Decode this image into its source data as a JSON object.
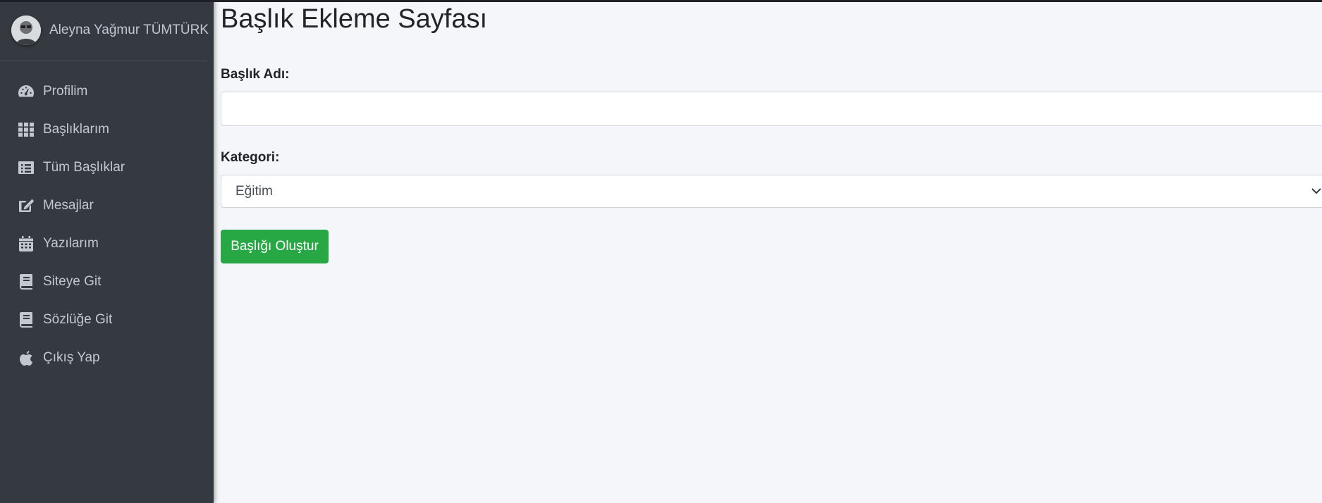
{
  "user": {
    "name": "Aleyna Yağmur TÜMTÜRK"
  },
  "sidebar": {
    "items": [
      {
        "label": "Profilim",
        "icon": "dashboard-icon"
      },
      {
        "label": "Başlıklarım",
        "icon": "grid-icon"
      },
      {
        "label": "Tüm Başlıklar",
        "icon": "list-icon"
      },
      {
        "label": "Mesajlar",
        "icon": "edit-icon"
      },
      {
        "label": "Yazılarım",
        "icon": "calendar-icon"
      },
      {
        "label": "Siteye Git",
        "icon": "book-icon"
      },
      {
        "label": "Sözlüğe Git",
        "icon": "book-icon"
      },
      {
        "label": "Çıkış Yap",
        "icon": "apple-icon"
      }
    ]
  },
  "main": {
    "title": "Başlık Ekleme Sayfası",
    "title_label": "Başlık Adı:",
    "title_value": "",
    "category_label": "Kategori:",
    "category_selected": "Eğitim",
    "submit_label": "Başlığı Oluştur"
  },
  "colors": {
    "sidebar_bg": "#343a40",
    "content_bg": "#f4f6f9",
    "button_success": "#28a745"
  }
}
